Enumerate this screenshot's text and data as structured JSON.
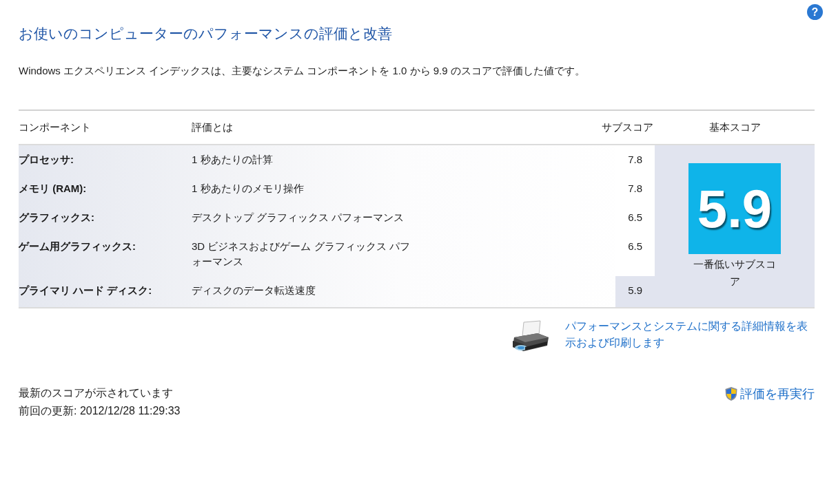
{
  "help": {
    "label": "?"
  },
  "title": "お使いのコンピューターのパフォーマンスの評価と改善",
  "description": "Windows エクスペリエンス インデックスは、主要なシステム コンポーネントを 1.0 から 9.9 のスコアで評価した値です。",
  "table": {
    "columns": [
      "コンポーネント",
      "評価とは",
      "サブスコア",
      "基本スコア"
    ],
    "rows": [
      {
        "component": "プロセッサ:",
        "rating": "1 秒あたりの計算",
        "subscore": "7.8",
        "lowest": false
      },
      {
        "component": "メモリ (RAM):",
        "rating": "1 秒あたりのメモリ操作",
        "subscore": "7.8",
        "lowest": false
      },
      {
        "component": "グラフィックス:",
        "rating": "デスクトップ グラフィックス パフォーマンス",
        "subscore": "6.5",
        "lowest": false
      },
      {
        "component": "ゲーム用グラフィックス:",
        "rating": "3D ビジネスおよびゲーム グラフィックス パフォーマンス",
        "subscore": "6.5",
        "lowest": false
      },
      {
        "component": "プライマリ ハード ディスク:",
        "rating": "ディスクのデータ転送速度",
        "subscore": "5.9",
        "lowest": true
      }
    ],
    "base_score": {
      "value": "5.9",
      "caption": "一番低いサブスコア"
    }
  },
  "details_link": "パフォーマンスとシステムに関する詳細情報を表示および印刷します",
  "status": {
    "message": "最新のスコアが示されています",
    "last_update": "前回の更新: 2012/12/28 11:29:33"
  },
  "rerun_link": "評価を再実行"
}
